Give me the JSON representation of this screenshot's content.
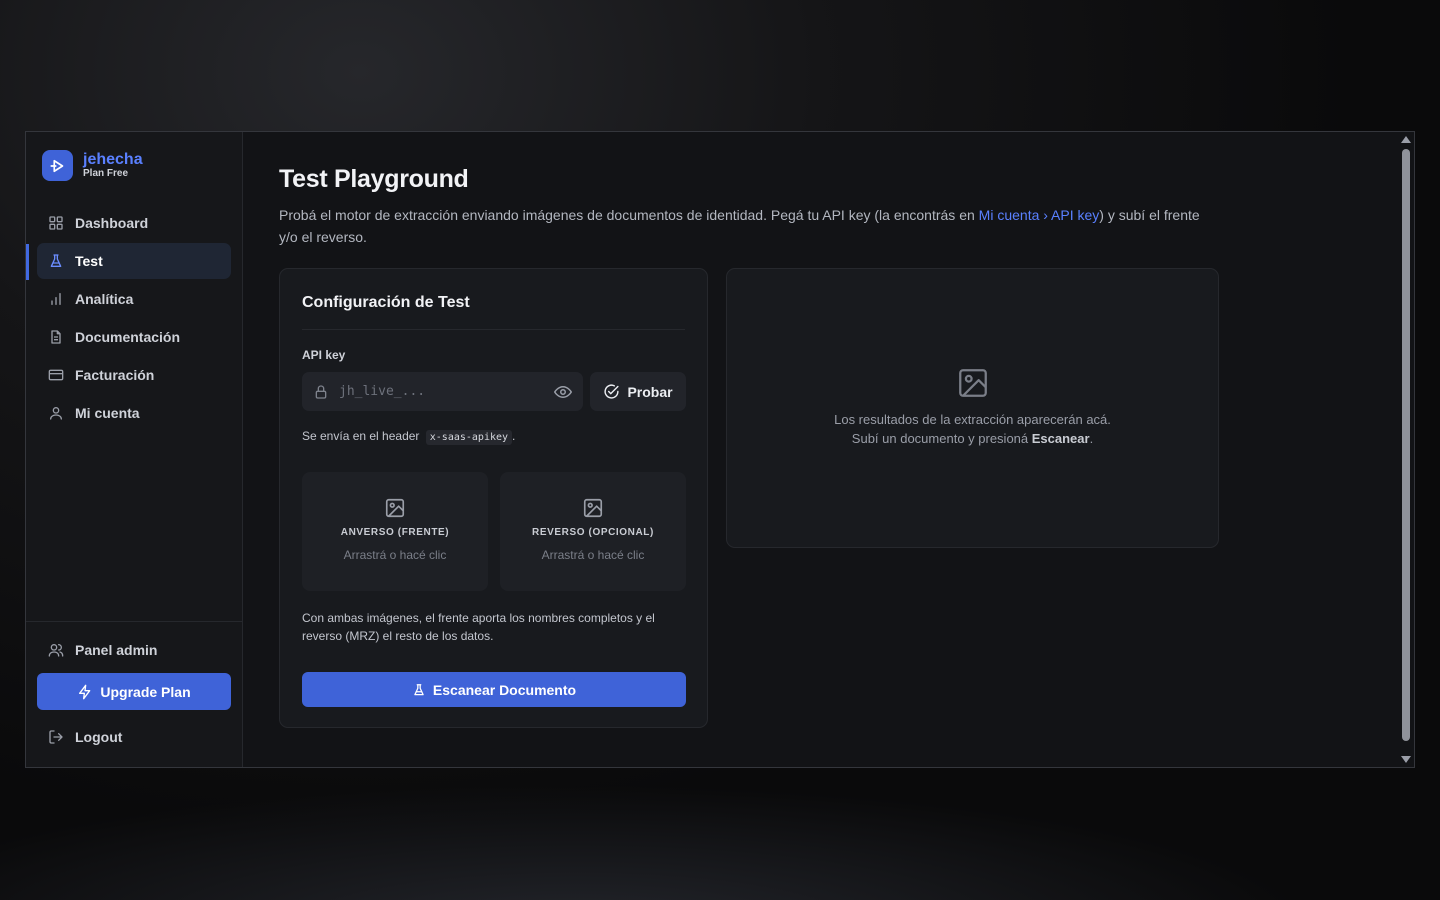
{
  "brand": {
    "name": "jehecha",
    "plan": "Plan Free"
  },
  "sidebar": {
    "items": [
      {
        "label": "Dashboard",
        "icon": "grid-icon"
      },
      {
        "label": "Test",
        "icon": "flask-icon",
        "active": true
      },
      {
        "label": "Analítica",
        "icon": "bar-chart-icon"
      },
      {
        "label": "Documentación",
        "icon": "document-icon"
      },
      {
        "label": "Facturación",
        "icon": "credit-card-icon"
      },
      {
        "label": "Mi cuenta",
        "icon": "user-icon"
      }
    ],
    "admin_label": "Panel admin",
    "upgrade_label": "Upgrade Plan",
    "logout_label": "Logout"
  },
  "page": {
    "title": "Test Playground",
    "desc_part1": "Probá el motor de extracción enviando imágenes de documentos de identidad. Pegá tu API key (la encontrás en ",
    "desc_link": "Mi cuenta › API key",
    "desc_part2": ") y subí el frente y/o el reverso."
  },
  "config": {
    "title": "Configuración de Test",
    "api_label": "API key",
    "api_placeholder": "jh_live_...",
    "api_value": "",
    "probar_label": "Probar",
    "header_note": "Se envía en el header",
    "header_code": "x-saas-apikey",
    "header_note_end": ".",
    "front_title": "ANVERSO (FRENTE)",
    "front_sub": "Arrastrá o hacé clic",
    "back_title": "REVERSO (OPCIONAL)",
    "back_sub": "Arrastrá o hacé clic",
    "hint": "Con ambas imágenes, el frente aporta los nombres completos y el reverso (MRZ) el resto de los datos.",
    "scan_label": "Escanear Documento"
  },
  "results": {
    "line1": "Los resultados de la extracción aparecerán acá.",
    "line2_prefix": "Subí un documento y presioná ",
    "line2_bold": "Escanear",
    "line2_suffix": "."
  },
  "colors": {
    "accent": "#3f63d8",
    "link": "#5a80ff",
    "background": "#121316"
  }
}
